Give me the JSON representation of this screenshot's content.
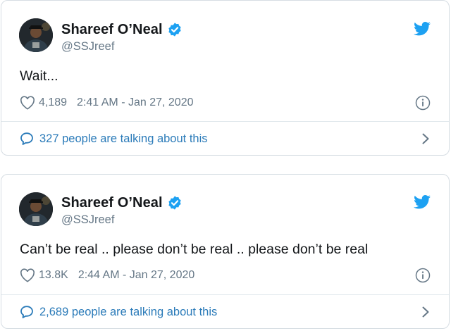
{
  "tweets": [
    {
      "display_name": "Shareef O’Neal",
      "handle": "@SSJreef",
      "text": "Wait...",
      "likes": "4,189",
      "timestamp": "2:41 AM - Jan 27, 2020",
      "talking": "327 people are talking about this"
    },
    {
      "display_name": "Shareef O’Neal",
      "handle": "@SSJreef",
      "text": "Can’t be real .. please don’t be real .. please don’t be real",
      "likes": "13.8K",
      "timestamp": "2:44 AM - Jan 27, 2020",
      "talking": "2,689 people are talking about this"
    }
  ],
  "icons": {
    "verified": "verified-badge-icon",
    "logo": "twitter-bird-icon",
    "like": "heart-icon",
    "info": "info-icon",
    "conversation": "speech-bubble-icon",
    "expand": "chevron-right-icon"
  },
  "colors": {
    "brand_blue": "#1da1f2",
    "link_blue": "#2b7bb9",
    "secondary_text": "#657786",
    "primary_text": "#14171a",
    "border": "#d6dde3"
  }
}
